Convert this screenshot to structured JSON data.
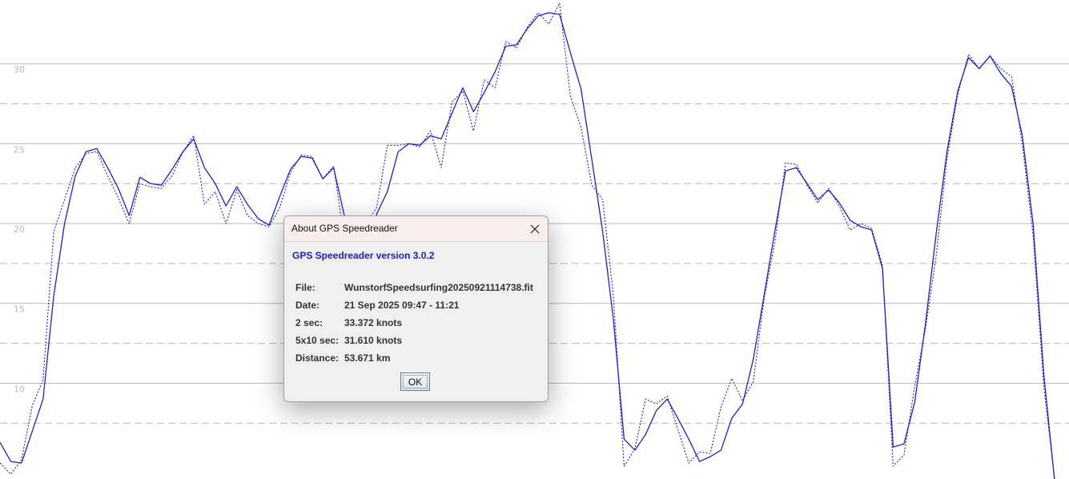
{
  "chart_data": {
    "type": "line",
    "ylim": [
      4,
      34
    ],
    "y_ticks": [
      10,
      15,
      20,
      25,
      30
    ],
    "grid": "horizontal",
    "series": [
      {
        "style": "solid",
        "values": [
          6.3,
          5.1,
          5.0,
          7.0,
          9.0,
          15.5,
          20.0,
          23.0,
          24.5,
          24.7,
          23.5,
          22.2,
          20.5,
          22.9,
          22.5,
          22.4,
          23.4,
          24.5,
          25.3,
          23.5,
          22.5,
          21.1,
          22.3,
          21.2,
          20.3,
          19.9,
          21.7,
          23.4,
          24.2,
          24.1,
          22.8,
          23.5,
          20.5,
          16.5,
          17.2,
          20.6,
          22.0,
          24.5,
          25.0,
          24.9,
          25.5,
          25.3,
          26.9,
          28.5,
          27.0,
          28.2,
          29.5,
          31.1,
          31.2,
          32.2,
          33.0,
          33.2,
          33.1,
          30.7,
          28.4,
          24.0,
          19.5,
          14.0,
          6.5,
          5.8,
          6.8,
          8.3,
          9.0,
          7.8,
          6.5,
          5.1,
          5.4,
          5.8,
          7.8,
          8.7,
          11.5,
          15.5,
          19.5,
          23.3,
          23.5,
          22.5,
          21.5,
          22.1,
          21.3,
          20.2,
          19.8,
          19.6,
          17.2,
          6.0,
          6.2,
          8.8,
          13.7,
          19.4,
          24.5,
          28.3,
          30.4,
          29.7,
          30.5,
          29.4,
          28.6,
          25.5,
          20.0,
          10.5,
          3.9
        ]
      },
      {
        "style": "dotted",
        "values": [
          5.0,
          4.3,
          5.2,
          8.6,
          10.2,
          19.5,
          21.5,
          23.5,
          24.4,
          24.5,
          23.0,
          21.6,
          20.0,
          22.5,
          22.3,
          22.2,
          23.0,
          24.5,
          25.5,
          21.2,
          22.0,
          20.0,
          22.1,
          20.5,
          20.0,
          19.8,
          21.0,
          23.2,
          24.3,
          24.2,
          22.8,
          23.6,
          19.0,
          16.0,
          20.0,
          21.0,
          24.9,
          24.9,
          25.0,
          24.8,
          25.8,
          23.5,
          27.6,
          28.3,
          25.8,
          29.0,
          28.5,
          31.4,
          31.0,
          32.3,
          33.2,
          32.5,
          33.8,
          28.0,
          26.0,
          22.4,
          21.5,
          15.5,
          4.8,
          5.9,
          9.0,
          8.7,
          9.2,
          7.1,
          5.0,
          5.7,
          5.6,
          8.5,
          10.3,
          8.9,
          10.1,
          15.3,
          18.8,
          23.8,
          23.7,
          22.4,
          21.3,
          22.2,
          21.1,
          19.6,
          20.0,
          19.7,
          17.4,
          4.8,
          5.5,
          9.8,
          13.4,
          18.0,
          24.1,
          28.1,
          30.6,
          29.7,
          30.5,
          29.7,
          29.2,
          25.0,
          19.3,
          9.8,
          4.0
        ]
      }
    ]
  },
  "dialog": {
    "title": "About GPS Speedreader",
    "heading": "GPS Speedreader version 3.0.2",
    "rows": [
      {
        "label": "File:",
        "value": "WunstorfSpeedsurfing20250921114738.fit"
      },
      {
        "label": "Date:",
        "value": "21 Sep 2025 09:47 - 11:21"
      },
      {
        "label": "2 sec:",
        "value": "33.372 knots"
      },
      {
        "label": "5x10 sec:",
        "value": "31.610 knots"
      },
      {
        "label": "Distance:",
        "value": "53.671 km"
      }
    ],
    "ok_label": "OK",
    "close_icon": "close-icon"
  },
  "colors": {
    "line": "#2020d0",
    "grid": "#b9b9b9",
    "heading": "#1a1ad6",
    "titlebar": "#f8eeee"
  }
}
